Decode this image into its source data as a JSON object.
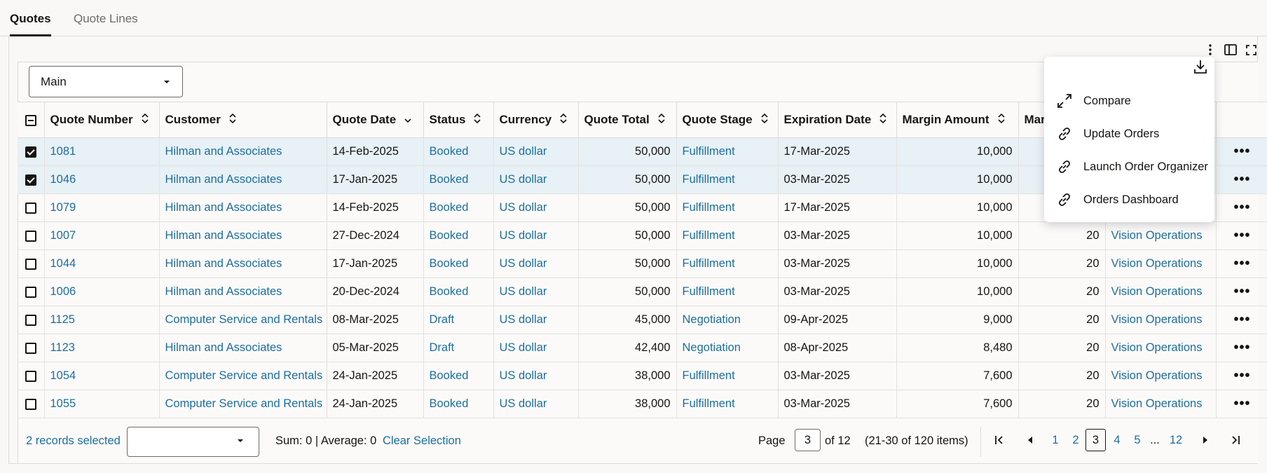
{
  "tabs": [
    {
      "label": "Quotes",
      "active": true
    },
    {
      "label": "Quote Lines",
      "active": false
    }
  ],
  "toolbar": {
    "icons": [
      "more-vertical-icon",
      "column-panel-icon",
      "fullscreen-icon"
    ]
  },
  "view_select": {
    "value": "Main"
  },
  "columns": [
    "Quote Number",
    "Customer",
    "Quote Date",
    "Status",
    "Currency",
    "Quote Total",
    "Quote Stage",
    "Expiration Date",
    "Margin Amount",
    "Mar",
    "",
    ""
  ],
  "rows": [
    {
      "selected": true,
      "cells": [
        "1081",
        "Hilman and Associates",
        "14-Feb-2025",
        "Booked",
        "US dollar",
        "50,000",
        "Fulfillment",
        "17-Mar-2025",
        "10,000",
        "",
        ""
      ]
    },
    {
      "selected": true,
      "cells": [
        "1046",
        "Hilman and Associates",
        "17-Jan-2025",
        "Booked",
        "US dollar",
        "50,000",
        "Fulfillment",
        "03-Mar-2025",
        "10,000",
        "",
        ""
      ]
    },
    {
      "selected": false,
      "cells": [
        "1079",
        "Hilman and Associates",
        "14-Feb-2025",
        "Booked",
        "US dollar",
        "50,000",
        "Fulfillment",
        "17-Mar-2025",
        "10,000",
        "",
        ""
      ]
    },
    {
      "selected": false,
      "cells": [
        "1007",
        "Hilman and Associates",
        "27-Dec-2024",
        "Booked",
        "US dollar",
        "50,000",
        "Fulfillment",
        "03-Mar-2025",
        "10,000",
        "20",
        "Vision Operations"
      ]
    },
    {
      "selected": false,
      "cells": [
        "1044",
        "Hilman and Associates",
        "17-Jan-2025",
        "Booked",
        "US dollar",
        "50,000",
        "Fulfillment",
        "03-Mar-2025",
        "10,000",
        "20",
        "Vision Operations"
      ]
    },
    {
      "selected": false,
      "cells": [
        "1006",
        "Hilman and Associates",
        "20-Dec-2024",
        "Booked",
        "US dollar",
        "50,000",
        "Fulfillment",
        "03-Mar-2025",
        "10,000",
        "20",
        "Vision Operations"
      ]
    },
    {
      "selected": false,
      "cells": [
        "1125",
        "Computer Service and Rentals",
        "08-Mar-2025",
        "Draft",
        "US dollar",
        "45,000",
        "Negotiation",
        "09-Apr-2025",
        "9,000",
        "20",
        "Vision Operations"
      ]
    },
    {
      "selected": false,
      "cells": [
        "1123",
        "Hilman and Associates",
        "05-Mar-2025",
        "Draft",
        "US dollar",
        "42,400",
        "Negotiation",
        "08-Apr-2025",
        "8,480",
        "20",
        "Vision Operations"
      ]
    },
    {
      "selected": false,
      "cells": [
        "1054",
        "Computer Service and Rentals",
        "24-Jan-2025",
        "Booked",
        "US dollar",
        "38,000",
        "Fulfillment",
        "03-Mar-2025",
        "7,600",
        "20",
        "Vision Operations"
      ]
    },
    {
      "selected": false,
      "cells": [
        "1055",
        "Computer Service and Rentals",
        "24-Jan-2025",
        "Booked",
        "US dollar",
        "38,000",
        "Fulfillment",
        "03-Mar-2025",
        "7,600",
        "20",
        "Vision Operations"
      ]
    }
  ],
  "footer": {
    "selected_count": "2 records selected",
    "select_value": "",
    "sum_label": "Sum: 0 | Average: 0",
    "clear_label": "Clear Selection",
    "page_label": "Page",
    "page_value": "3",
    "of_label": "of 12",
    "range_label": "(21-30 of 120 items)",
    "pages": [
      "1",
      "2",
      "3",
      "4",
      "5",
      "...",
      "12"
    ],
    "current_page": "3"
  },
  "menu": {
    "items": [
      {
        "label": "Compare",
        "icon": "compare-icon"
      },
      {
        "label": "Update Orders",
        "icon": "link-icon"
      },
      {
        "label": "Launch Order Organizer",
        "icon": "link-icon"
      },
      {
        "label": "Orders Dashboard",
        "icon": "link-icon"
      }
    ],
    "download_icon": "download-icon"
  },
  "colors": {
    "link": "#1c6e9f",
    "selected_row": "#e7f1f6",
    "text": "#161513"
  }
}
